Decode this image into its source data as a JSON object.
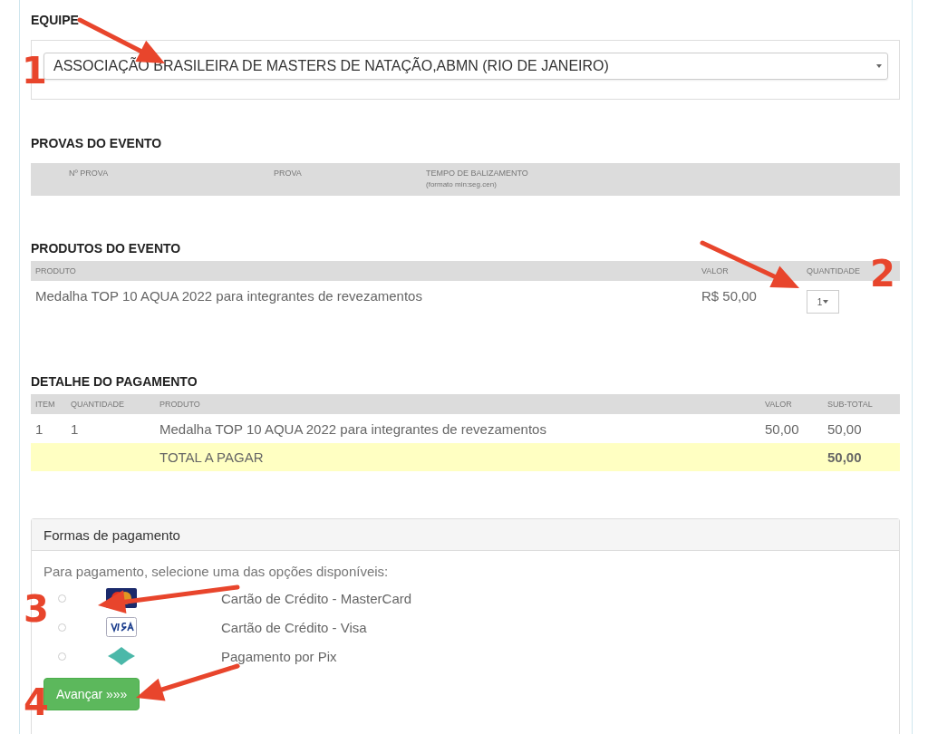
{
  "team": {
    "label": "EQUIPE",
    "value": "ASSOCIAÇÃO BRASILEIRA DE MASTERS DE NATAÇÃO,ABMN (RIO DE JANEIRO)"
  },
  "events": {
    "title": "PROVAS DO EVENTO",
    "columns": [
      "Nº PROVA",
      "PROVA",
      "TEMPO DE BALIZAMENTO"
    ],
    "column_note": "(formato min:seg.cen)"
  },
  "products": {
    "title": "PRODUTOS DO EVENTO",
    "columns": [
      "PRODUTO",
      "VALOR",
      "QUANTIDADE"
    ],
    "rows": [
      {
        "product": "Medalha TOP 10 AQUA 2022 para integrantes de revezamentos",
        "price": "R$ 50,00",
        "quantity": "1"
      }
    ]
  },
  "payment_detail": {
    "title": "DETALHE DO PAGAMENTO",
    "columns": [
      "ITEM",
      "QUANTIDADE",
      "PRODUTO",
      "VALOR",
      "SUB-TOTAL"
    ],
    "rows": [
      {
        "item": "1",
        "quantity": "1",
        "product": "Medalha TOP 10 AQUA 2022 para integrantes de revezamentos",
        "value": "50,00",
        "subtotal": "50,00"
      }
    ],
    "total": {
      "label": "TOTAL A PAGAR",
      "value": "50,00"
    }
  },
  "payment_methods": {
    "title": "Formas de pagamento",
    "instruction": "Para pagamento, selecione uma das opções disponíveis:",
    "options": [
      {
        "kind": "mastercard",
        "label": "Cartão de Crédito - MasterCard",
        "selected": false
      },
      {
        "kind": "visa",
        "label": "Cartão de Crédito - Visa",
        "selected": false
      },
      {
        "kind": "pix",
        "label": "Pagamento por Pix",
        "selected": false
      }
    ],
    "button": "Avançar »»»"
  },
  "annotations": [
    {
      "number": "1"
    },
    {
      "number": "2"
    },
    {
      "number": "3"
    },
    {
      "number": "4"
    }
  ]
}
